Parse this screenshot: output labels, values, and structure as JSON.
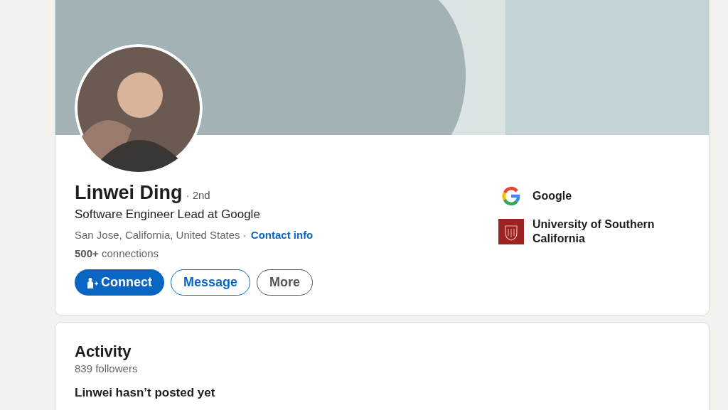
{
  "profile": {
    "name": "Linwei Ding",
    "degree": "· 2nd",
    "headline": "Software Engineer Lead at Google",
    "location": "San Jose, California, United States ·",
    "contact_link": "Contact info",
    "connections": "**500+** connections",
    "buttons": [
      {
        "label": "Connect",
        "kind": "primary"
      },
      {
        "label": "Message",
        "kind": "secondary"
      },
      {
        "label": "More",
        "kind": "tertiary"
      }
    ]
  },
  "organizations": [
    {
      "name": "Google",
      "kind": "company"
    },
    {
      "name": "University of Southern California",
      "kind": "school"
    }
  ],
  "activity": {
    "title": "Activity",
    "followers": "839 followers",
    "empty_title": "Linwei hasn’t posted yet"
  }
}
